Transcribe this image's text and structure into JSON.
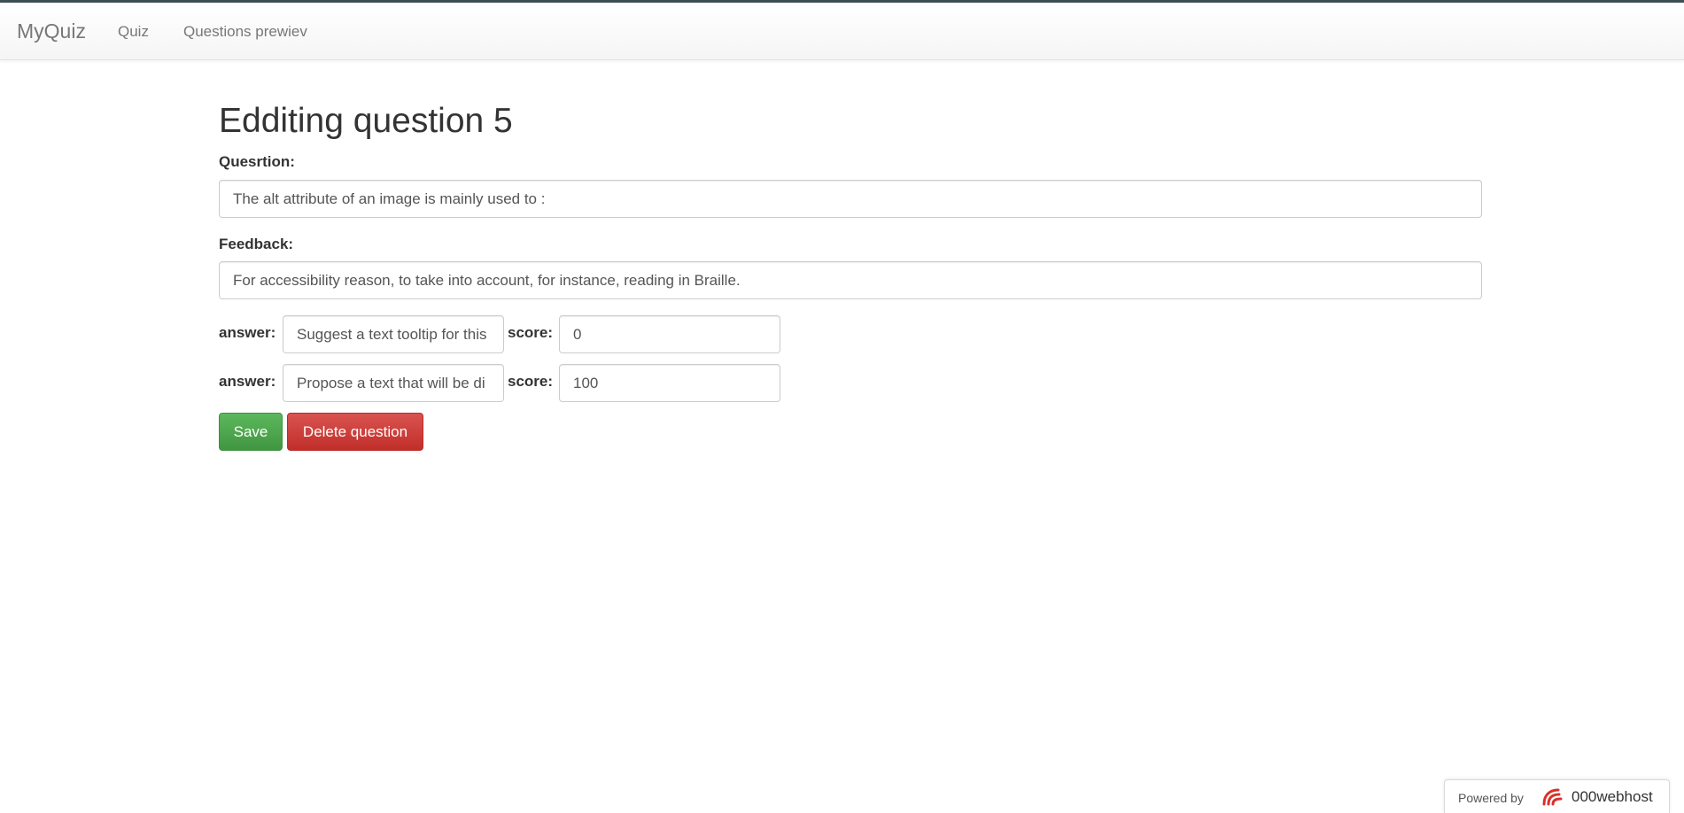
{
  "navbar": {
    "brand": "MyQuiz",
    "links": [
      {
        "label": "Quiz"
      },
      {
        "label": "Questions prewiev"
      }
    ]
  },
  "page": {
    "title": "Edditing question 5"
  },
  "form": {
    "question_label": "Quesrtion:",
    "question_value": "The alt attribute of an image is mainly used to :",
    "feedback_label": "Feedback:",
    "feedback_value": "For accessibility reason, to take into account, for instance, reading in Braille.",
    "answers": [
      {
        "answer_label": "answer:",
        "answer_value": "Suggest a text tooltip for this",
        "score_label": "score:",
        "score_value": "0"
      },
      {
        "answer_label": "answer:",
        "answer_value": "Propose a text that will be di",
        "score_label": "score:",
        "score_value": "100"
      }
    ],
    "save_label": "Save",
    "delete_label": "Delete question"
  },
  "footer": {
    "powered_by": "Powered by",
    "host_name": "000webhost",
    "host_icon": "000webhost-logo-icon"
  },
  "colors": {
    "save": "#5cb85c",
    "delete": "#d9534f",
    "topline": "#3f4f56"
  }
}
